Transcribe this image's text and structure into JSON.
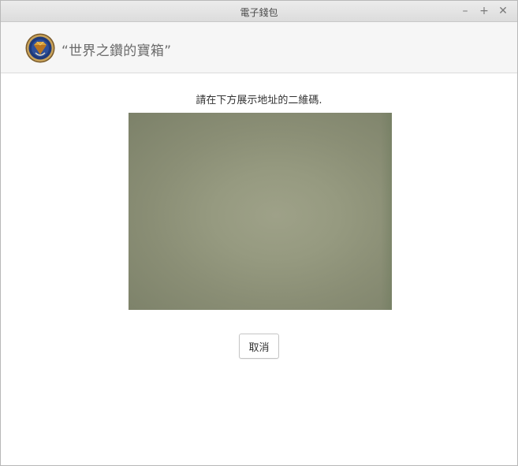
{
  "window": {
    "title": "電子錢包",
    "controls": {
      "minimize": "–",
      "maximize": "+",
      "close": "✕"
    }
  },
  "header": {
    "wallet_name": "“世界之鑽的寶箱”",
    "logo_icon": "diamond-emblem-icon"
  },
  "main": {
    "instruction": "請在下方展示地址的二維碼.",
    "camera_feed": "camera-preview",
    "cancel_label": "取消"
  },
  "colors": {
    "titlebar": "#e4e4e4",
    "header_bg": "#f6f6f6",
    "camera_tint": "#969a80"
  }
}
